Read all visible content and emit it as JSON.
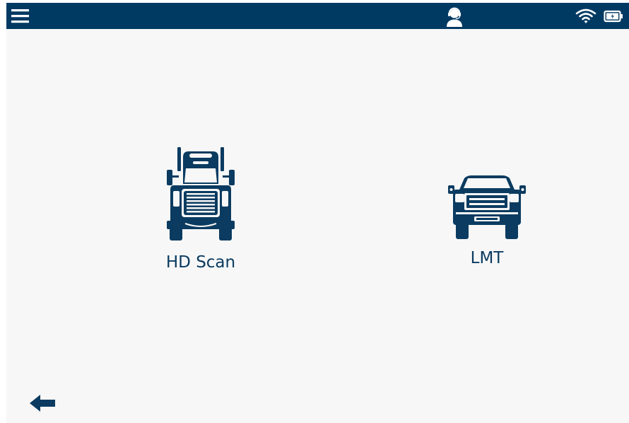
{
  "colors": {
    "topbar": "#003a63",
    "accent": "#0b3b60",
    "background": "#f7f7f7"
  },
  "topbar": {
    "menu_icon": "hamburger-menu-icon",
    "support_icon": "headset-support-icon",
    "wifi_icon": "wifi-icon",
    "battery_icon": "battery-charging-icon"
  },
  "main": {
    "tiles": [
      {
        "label": "HD Scan",
        "icon": "semi-truck-icon"
      },
      {
        "label": "LMT",
        "icon": "pickup-truck-icon"
      }
    ]
  },
  "footer": {
    "back_icon": "back-arrow-icon"
  }
}
